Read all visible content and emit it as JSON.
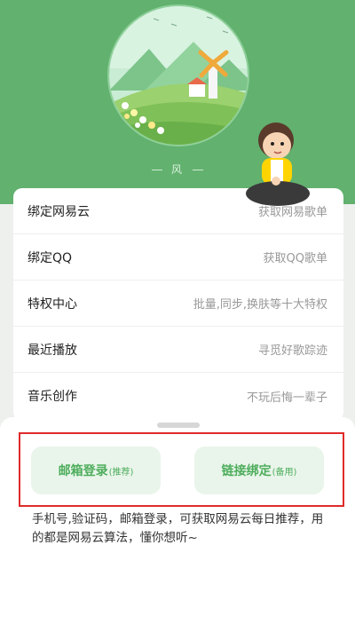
{
  "profile": {
    "name": "风"
  },
  "menu": [
    {
      "label": "绑定网易云",
      "desc": "获取网易歌单"
    },
    {
      "label": "绑定QQ",
      "desc": "获取QQ歌单"
    },
    {
      "label": "特权中心",
      "desc": "批量,同步,换肤等十大特权"
    },
    {
      "label": "最近播放",
      "desc": "寻觅好歌踪迹"
    },
    {
      "label": "音乐创作",
      "desc": "不玩后悔一辈子"
    }
  ],
  "sheet": {
    "email_login": {
      "label": "邮箱登录",
      "sub": "(推荐)"
    },
    "link_bind": {
      "label": "链接绑定",
      "sub": "(备用)"
    },
    "note": "手机号,验证码，邮箱登录，可获取网易云每日推荐，用的都是网易云算法，懂你想听~"
  },
  "colors": {
    "header_green": "#62b16f",
    "button_text": "#4dad5c",
    "button_bg": "#e9f5ea",
    "highlight_red": "#e02a2a"
  }
}
